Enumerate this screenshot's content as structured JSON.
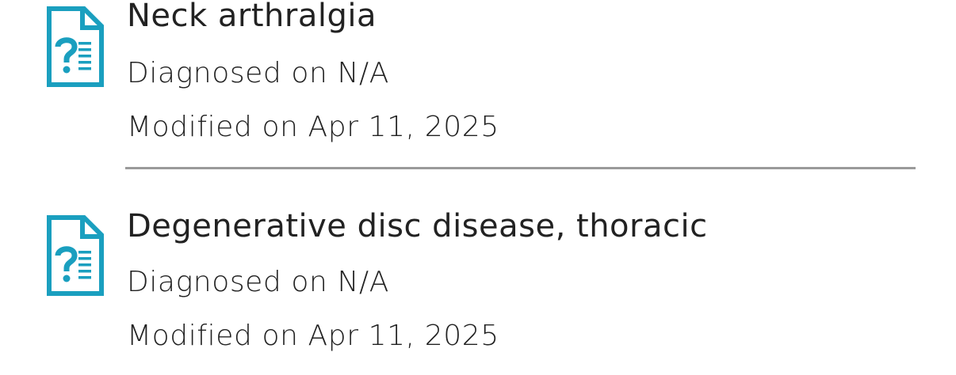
{
  "conditions": [
    {
      "icon": "diagnosis-document-icon",
      "title": "Neck arthralgia",
      "diagnosed": "Diagnosed on N/A",
      "modified": "Modified on Apr 11, 2025"
    },
    {
      "icon": "diagnosis-document-icon",
      "title": "Degenerative disc disease, thoracic",
      "diagnosed": "Diagnosed on N/A",
      "modified": "Modified on Apr 11, 2025"
    }
  ],
  "colors": {
    "icon": "#1a9fbf",
    "text": "#222222",
    "divider": "#9a9a9a",
    "background": "#ffffff"
  }
}
